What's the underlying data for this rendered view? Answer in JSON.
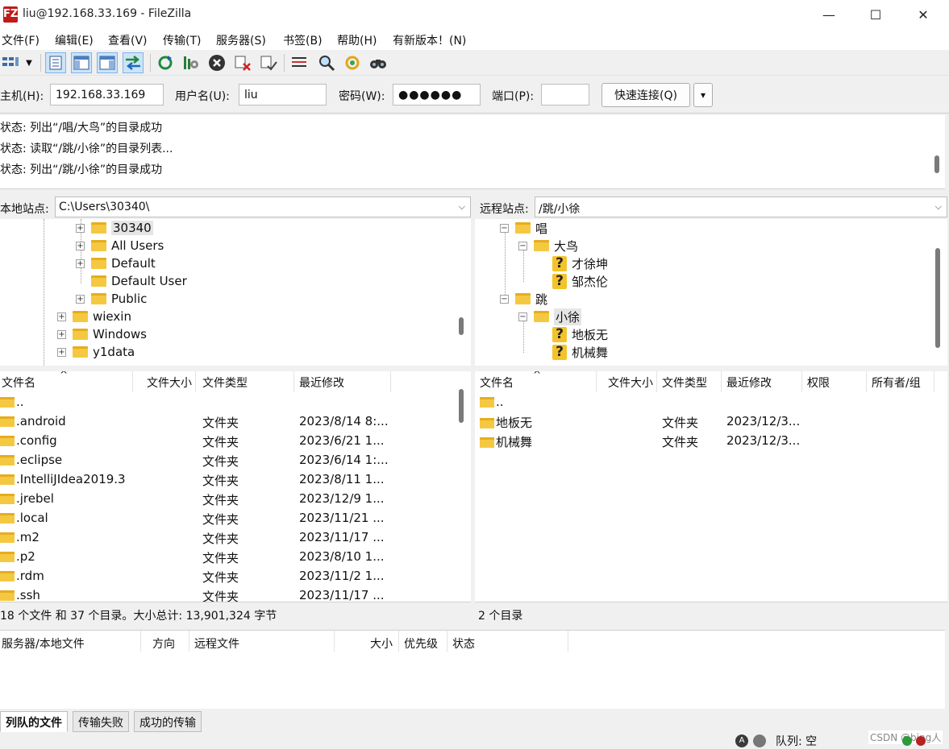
{
  "window": {
    "title": "liu@192.168.33.169 - FileZilla",
    "logo": "FZ",
    "minimize": "—",
    "maximize": "☐",
    "close": "✕"
  },
  "menu": [
    "文件(F)",
    "编辑(E)",
    "查看(V)",
    "传输(T)",
    "服务器(S)",
    "书签(B)",
    "帮助(H)",
    "有新版本！(N)"
  ],
  "toolbar_icons": [
    "site-manager-icon",
    "dropdown-arrow-icon",
    "message-log-icon",
    "local-tree-icon",
    "remote-tree-icon",
    "transfer-queue-icon",
    "refresh-icon",
    "process-queue-icon",
    "cancel-icon",
    "disconnect-icon",
    "reconnect-icon",
    "filter-icon",
    "compare-icon",
    "sync-browse-icon",
    "search-icon"
  ],
  "quickconnect": {
    "host_label": "主机(H):",
    "host_value": "192.168.33.169",
    "user_label": "用户名(U):",
    "user_value": "liu",
    "pass_label": "密码(W):",
    "pass_value": "●●●●●●",
    "port_label": "端口(P):",
    "port_value": "",
    "connect_button": "快速连接(Q)",
    "dropdown": "▾"
  },
  "log": [
    {
      "prefix": "状态:",
      "text": "列出“/唱/大鸟”的目录成功"
    },
    {
      "prefix": "状态:",
      "text": "读取“/跳/小徐”的目录列表..."
    },
    {
      "prefix": "状态:",
      "text": "列出“/跳/小徐”的目录成功"
    }
  ],
  "local": {
    "site_label": "本地站点:",
    "path": "C:\\Users\\30340\\",
    "tree": [
      {
        "name": "30340",
        "selected": true,
        "exp": "+"
      },
      {
        "name": "All Users",
        "exp": "+"
      },
      {
        "name": "Default",
        "exp": "+"
      },
      {
        "name": "Default User",
        "exp": ""
      },
      {
        "name": "Public",
        "exp": "+"
      },
      {
        "name": "wiexin",
        "exp": "+"
      },
      {
        "name": "Windows",
        "exp": "+"
      },
      {
        "name": "y1data",
        "exp": "+"
      }
    ],
    "columns": [
      "文件名",
      "文件大小",
      "文件类型",
      "最近修改"
    ],
    "sort_indicator": "^",
    "files": [
      {
        "name": "..",
        "size": "",
        "type": "",
        "modified": ""
      },
      {
        "name": ".android",
        "size": "",
        "type": "文件夹",
        "modified": "2023/8/14 8:..."
      },
      {
        "name": ".config",
        "size": "",
        "type": "文件夹",
        "modified": "2023/6/21 1..."
      },
      {
        "name": ".eclipse",
        "size": "",
        "type": "文件夹",
        "modified": "2023/6/14 1:..."
      },
      {
        "name": ".IntelliJIdea2019.3",
        "size": "",
        "type": "文件夹",
        "modified": "2023/8/11 1..."
      },
      {
        "name": ".jrebel",
        "size": "",
        "type": "文件夹",
        "modified": "2023/12/9 1..."
      },
      {
        "name": ".local",
        "size": "",
        "type": "文件夹",
        "modified": "2023/11/21 ..."
      },
      {
        "name": ".m2",
        "size": "",
        "type": "文件夹",
        "modified": "2023/11/17 ..."
      },
      {
        "name": ".p2",
        "size": "",
        "type": "文件夹",
        "modified": "2023/8/10 1..."
      },
      {
        "name": ".rdm",
        "size": "",
        "type": "文件夹",
        "modified": "2023/11/2 1..."
      },
      {
        "name": ".ssh",
        "size": "",
        "type": "文件夹",
        "modified": "2023/11/17 ..."
      }
    ],
    "status": "18 个文件 和 37 个目录。大小总计: 13,901,324 字节"
  },
  "remote": {
    "site_label": "远程站点:",
    "path": "/跳/小徐",
    "tree": [
      {
        "name": "唱",
        "kind": "folder",
        "exp": "−"
      },
      {
        "name": "大鸟",
        "kind": "folder",
        "exp": "−"
      },
      {
        "name": "才徐坤",
        "kind": "unknown"
      },
      {
        "name": "邹杰伦",
        "kind": "unknown"
      },
      {
        "name": "跳",
        "kind": "folder",
        "exp": "−"
      },
      {
        "name": "小徐",
        "kind": "folder",
        "exp": "−",
        "selected": true
      },
      {
        "name": "地板无",
        "kind": "unknown"
      },
      {
        "name": "机械舞",
        "kind": "unknown"
      }
    ],
    "columns": [
      "文件名",
      "文件大小",
      "文件类型",
      "最近修改",
      "权限",
      "所有者/组"
    ],
    "files": [
      {
        "name": "..",
        "type": "",
        "modified": ""
      },
      {
        "name": "地板无",
        "type": "文件夹",
        "modified": "2023/12/3..."
      },
      {
        "name": "机械舞",
        "type": "文件夹",
        "modified": "2023/12/3..."
      }
    ],
    "status": "2 个目录"
  },
  "queue": {
    "columns": [
      "服务器/本地文件",
      "方向",
      "远程文件",
      "大小",
      "优先级",
      "状态"
    ],
    "tabs": [
      "列队的文件",
      "传输失败",
      "成功的传输"
    ]
  },
  "statusbar": {
    "queue_text": "队列: 空",
    "watermark": "CSDN @bing人"
  }
}
